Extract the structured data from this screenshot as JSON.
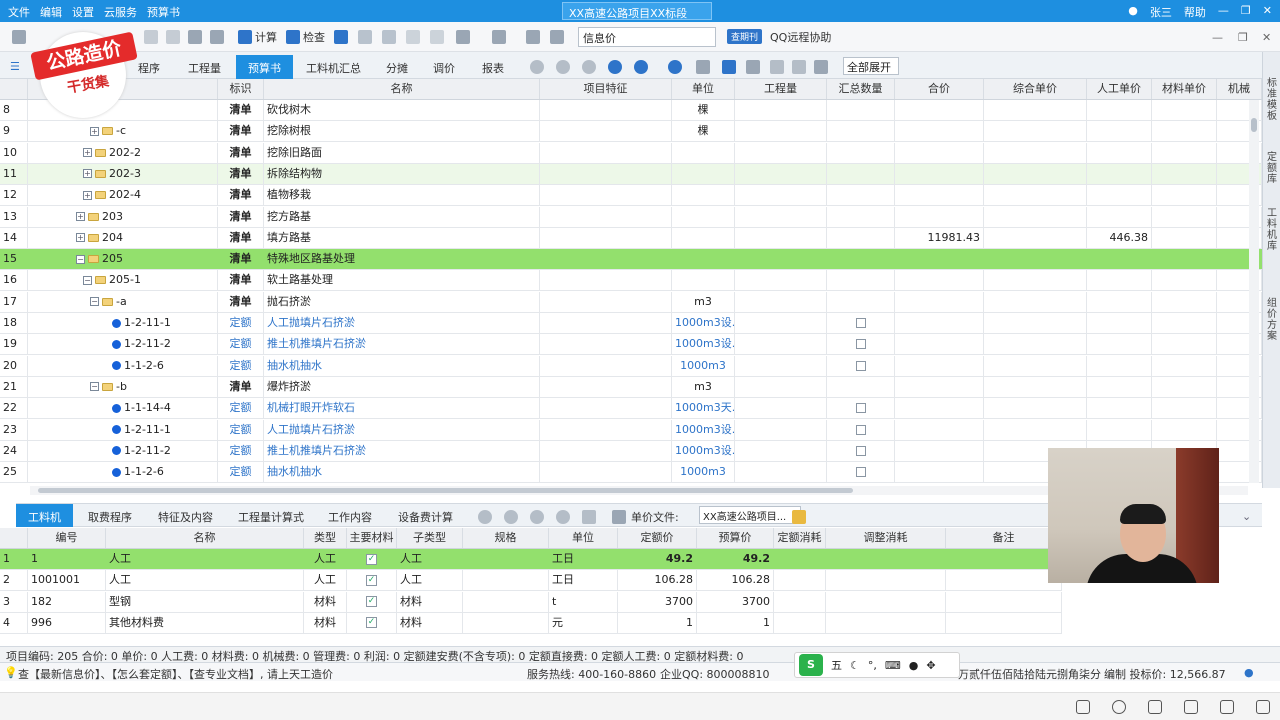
{
  "titlebar": {
    "menu": [
      "文件",
      "编辑",
      "设置",
      "云服务",
      "预算书"
    ],
    "project_title": "XX高速公路项目XX标段",
    "user": "张三",
    "help": "帮助"
  },
  "toolbar1": {
    "calc": "计算",
    "check": "检查",
    "search_placeholder": "信息价",
    "periodical_button": "查期刊",
    "remote": "QQ远程协助"
  },
  "toolbar2": {
    "tabs": [
      "程序",
      "工程量",
      "预算书",
      "工料机汇总",
      "分摊",
      "调价",
      "报表"
    ],
    "active_tab": "预算书",
    "expand_select": "全部展开"
  },
  "right_tabs": [
    "标准模板",
    "定额库",
    "工料机库",
    "组价方案"
  ],
  "grid": {
    "headers": [
      "",
      "",
      "标识",
      "名称",
      "项目特征",
      "单位",
      "工程量",
      "汇总数量",
      "合价",
      "综合单价",
      "人工单价",
      "材料单价",
      "机械"
    ],
    "rows": [
      {
        "no": "8",
        "code": "",
        "type": "清单",
        "name": "砍伐树木",
        "unit": "棵",
        "total": "",
        "labor": "",
        "kind": "partial",
        "style": ""
      },
      {
        "no": "9",
        "code": "-c",
        "type": "清单",
        "name": "挖除树根",
        "unit": "棵",
        "total": "",
        "labor": "",
        "kind": "folder3",
        "style": ""
      },
      {
        "no": "10",
        "code": "202-2",
        "type": "清单",
        "name": "挖除旧路面",
        "unit": "",
        "total": "",
        "labor": "",
        "kind": "folder2",
        "style": ""
      },
      {
        "no": "11",
        "code": "202-3",
        "type": "清单",
        "name": "拆除结构物",
        "unit": "",
        "total": "",
        "labor": "",
        "kind": "folder2",
        "style": "light"
      },
      {
        "no": "12",
        "code": "202-4",
        "type": "清单",
        "name": "植物移栽",
        "unit": "",
        "total": "",
        "labor": "",
        "kind": "folder2",
        "style": ""
      },
      {
        "no": "13",
        "code": "203",
        "type": "清单",
        "name": "挖方路基",
        "unit": "",
        "total": "",
        "labor": "",
        "kind": "folder1",
        "style": ""
      },
      {
        "no": "14",
        "code": "204",
        "type": "清单",
        "name": "填方路基",
        "unit": "",
        "total": "11981.43",
        "labor": "446.38",
        "kind": "folder1",
        "style": ""
      },
      {
        "no": "15",
        "code": "205",
        "type": "清单",
        "name": "特殊地区路基处理",
        "unit": "",
        "total": "",
        "labor": "",
        "kind": "folder1open",
        "style": "sel"
      },
      {
        "no": "16",
        "code": "205-1",
        "type": "清单",
        "name": "软土路基处理",
        "unit": "",
        "total": "",
        "labor": "",
        "kind": "folder2open",
        "style": ""
      },
      {
        "no": "17",
        "code": "-a",
        "type": "清单",
        "name": "抛石挤淤",
        "unit": "m3",
        "total": "",
        "labor": "",
        "kind": "folder3open",
        "style": ""
      },
      {
        "no": "18",
        "code": "1-2-11-1",
        "type": "定额",
        "name": "人工抛填片石挤淤",
        "unit": "1000m3设...",
        "total": "",
        "labor": "",
        "kind": "dot",
        "style": ""
      },
      {
        "no": "19",
        "code": "1-2-11-2",
        "type": "定额",
        "name": "推土机推填片石挤淤",
        "unit": "1000m3设...",
        "total": "",
        "labor": "",
        "kind": "dot",
        "style": ""
      },
      {
        "no": "20",
        "code": "1-1-2-6",
        "type": "定额",
        "name": "抽水机抽水",
        "unit": "1000m3",
        "total": "",
        "labor": "",
        "kind": "dot",
        "style": ""
      },
      {
        "no": "21",
        "code": "-b",
        "type": "清单",
        "name": "爆炸挤淤",
        "unit": "m3",
        "total": "",
        "labor": "",
        "kind": "folder3open",
        "style": ""
      },
      {
        "no": "22",
        "code": "1-1-14-4",
        "type": "定额",
        "name": "机械打眼开炸软石",
        "unit": "1000m3天...",
        "total": "",
        "labor": "",
        "kind": "dot",
        "style": ""
      },
      {
        "no": "23",
        "code": "1-2-11-1",
        "type": "定额",
        "name": "人工抛填片石挤淤",
        "unit": "1000m3设...",
        "total": "",
        "labor": "",
        "kind": "dot",
        "style": ""
      },
      {
        "no": "24",
        "code": "1-2-11-2",
        "type": "定额",
        "name": "推土机推填片石挤淤",
        "unit": "1000m3设...",
        "total": "",
        "labor": "",
        "kind": "dot",
        "style": ""
      },
      {
        "no": "25",
        "code": "1-1-2-6",
        "type": "定额",
        "name": "抽水机抽水",
        "unit": "1000m3",
        "total": "",
        "labor": "",
        "kind": "dot",
        "style": ""
      }
    ]
  },
  "bottom_tabs": {
    "tabs": [
      "工料机",
      "取费程序",
      "特征及内容",
      "工程量计算式",
      "工作内容",
      "设备费计算"
    ],
    "active": "工料机",
    "price_file_label": "单价文件:",
    "price_file_value": "XX高速公路项目..."
  },
  "grid2": {
    "headers": [
      "",
      "编号",
      "名称",
      "类型",
      "主要材料",
      "子类型",
      "规格",
      "单位",
      "定额价",
      "预算价",
      "定额消耗",
      "调整消耗",
      "备注"
    ],
    "rows": [
      {
        "no": "1",
        "code": "1",
        "name": "人工",
        "type": "人工",
        "main": true,
        "subtype": "人工",
        "unit": "工日",
        "quota": "49.2",
        "budget": "49.2",
        "sel": true
      },
      {
        "no": "2",
        "code": "1001001",
        "name": "人工",
        "type": "人工",
        "main": true,
        "subtype": "人工",
        "unit": "工日",
        "quota": "106.28",
        "budget": "106.28",
        "sel": false
      },
      {
        "no": "3",
        "code": "182",
        "name": "型钢",
        "type": "材料",
        "main": true,
        "subtype": "材料",
        "unit": "t",
        "quota": "3700",
        "budget": "3700",
        "sel": false
      },
      {
        "no": "4",
        "code": "996",
        "name": "其他材料费",
        "type": "材料",
        "main": true,
        "subtype": "材料",
        "unit": "元",
        "quota": "1",
        "budget": "1",
        "sel": false
      }
    ]
  },
  "statusbar": {
    "text": "项目编码: 205 合价: 0 单价: 0 人工费: 0 材料费: 0 机械费: 0 管理费: 0 利润: 0 定额建安费(不含专项): 0 定额直接费: 0 定额人工费: 0 定额材料费: 0"
  },
  "infobar": {
    "tips": "查【最新信息价】、【怎么套定额】、【查专业文档】, 请上天工造价",
    "hotline": "服务热线: 400-160-8860",
    "qq": "企业QQ: 800008810",
    "amount_words": "万贰仟伍佰陆拾陆元捌角柒分",
    "bid_label": "编制 投标价: 12,566.87"
  },
  "watermark": {
    "line1": "公路造价",
    "line2": "干货集"
  },
  "ime": {
    "mode": "五"
  }
}
